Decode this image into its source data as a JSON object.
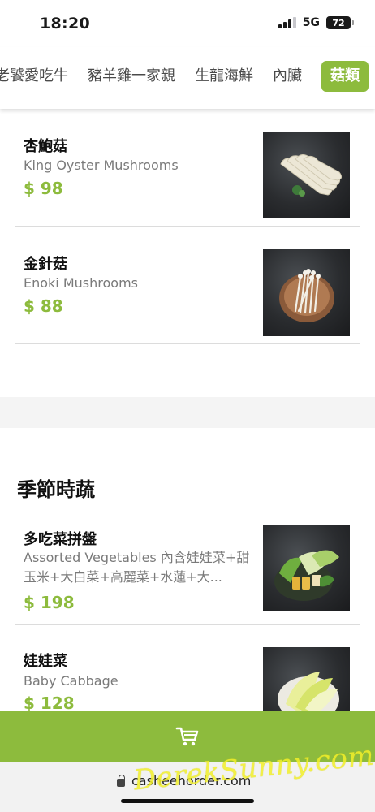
{
  "status_bar": {
    "time": "18:20",
    "network": "5G",
    "battery": "72"
  },
  "category_tabs": [
    {
      "label": "老饕愛吃牛",
      "active": false
    },
    {
      "label": "豬羊雞一家親",
      "active": false
    },
    {
      "label": "生龍海鮮",
      "active": false
    },
    {
      "label": "內臟",
      "active": false
    },
    {
      "label": "菇類",
      "active": true
    }
  ],
  "mushroom_items": [
    {
      "name": "杏鮑菇",
      "name_en": "King Oyster Mushrooms",
      "price": "$ 98"
    },
    {
      "name": "金針菇",
      "name_en": "Enoki Mushrooms",
      "price": "$ 88"
    }
  ],
  "seasonal_section": {
    "title": "季節時蔬",
    "items": [
      {
        "name": "多吃菜拼盤",
        "name_en": "Assorted Vegetables 內含娃娃菜+甜玉米+大白菜+高麗菜+水蓮+大...",
        "price": "$ 198"
      },
      {
        "name": "娃娃菜",
        "name_en": "Baby Cabbage",
        "price": "$ 128"
      }
    ]
  },
  "cart": {
    "icon": "shopping-cart-icon"
  },
  "browser": {
    "url": "casheehorder.com"
  },
  "watermark": "DerekSunny.com",
  "colors": {
    "accent": "#8dbb3d",
    "text": "#111111",
    "subtext": "#7a7a7a"
  }
}
